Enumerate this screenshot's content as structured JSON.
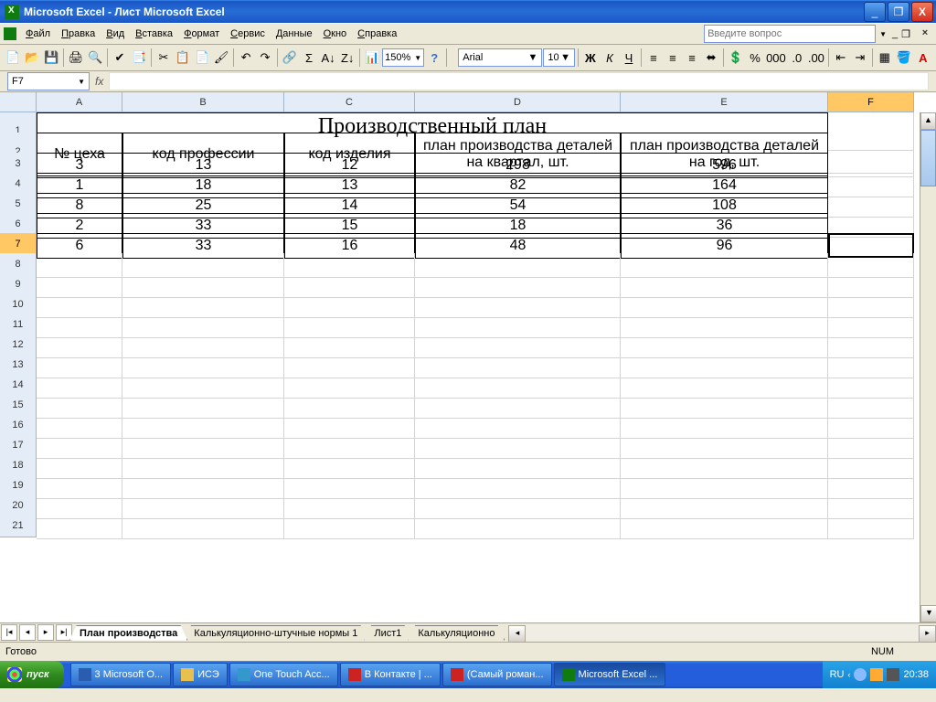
{
  "window": {
    "app": "Microsoft Excel",
    "doc": "Лист Microsoft Excel"
  },
  "menu": [
    "Файл",
    "Правка",
    "Вид",
    "Вставка",
    "Формат",
    "Сервис",
    "Данные",
    "Окно",
    "Справка"
  ],
  "ask_placeholder": "Введите вопрос",
  "zoom": "150%",
  "font": {
    "name": "Arial",
    "size": "10"
  },
  "namebox": "F7",
  "columns": [
    "A",
    "B",
    "C",
    "D",
    "E",
    "F"
  ],
  "rows_visible": 21,
  "selected_cell": {
    "row": 7,
    "col": "F"
  },
  "table": {
    "title": "Производственный план",
    "headers": [
      "№ цеха",
      "код профессии",
      "код изделия",
      "план производства деталей на квартал, шт.",
      "план производства деталей на год, шт."
    ],
    "rows": [
      [
        "3",
        "13",
        "12",
        "298",
        "596"
      ],
      [
        "1",
        "18",
        "13",
        "82",
        "164"
      ],
      [
        "8",
        "25",
        "14",
        "54",
        "108"
      ],
      [
        "2",
        "33",
        "15",
        "18",
        "36"
      ],
      [
        "6",
        "33",
        "16",
        "48",
        "96"
      ]
    ]
  },
  "sheets": {
    "active": "План производства",
    "others": [
      "Калькуляционно-штучные нормы 1",
      "Лист1",
      "Калькуляционно"
    ]
  },
  "status": {
    "ready": "Готово",
    "num": "NUM"
  },
  "taskbar": {
    "start": "пуск",
    "lang": "RU",
    "clock": "20:38",
    "items": [
      "3 Microsoft O...",
      "ИСЭ",
      "One Touch Acc...",
      "В Контакте | ...",
      "(Самый роман...",
      "Microsoft Excel ..."
    ]
  }
}
